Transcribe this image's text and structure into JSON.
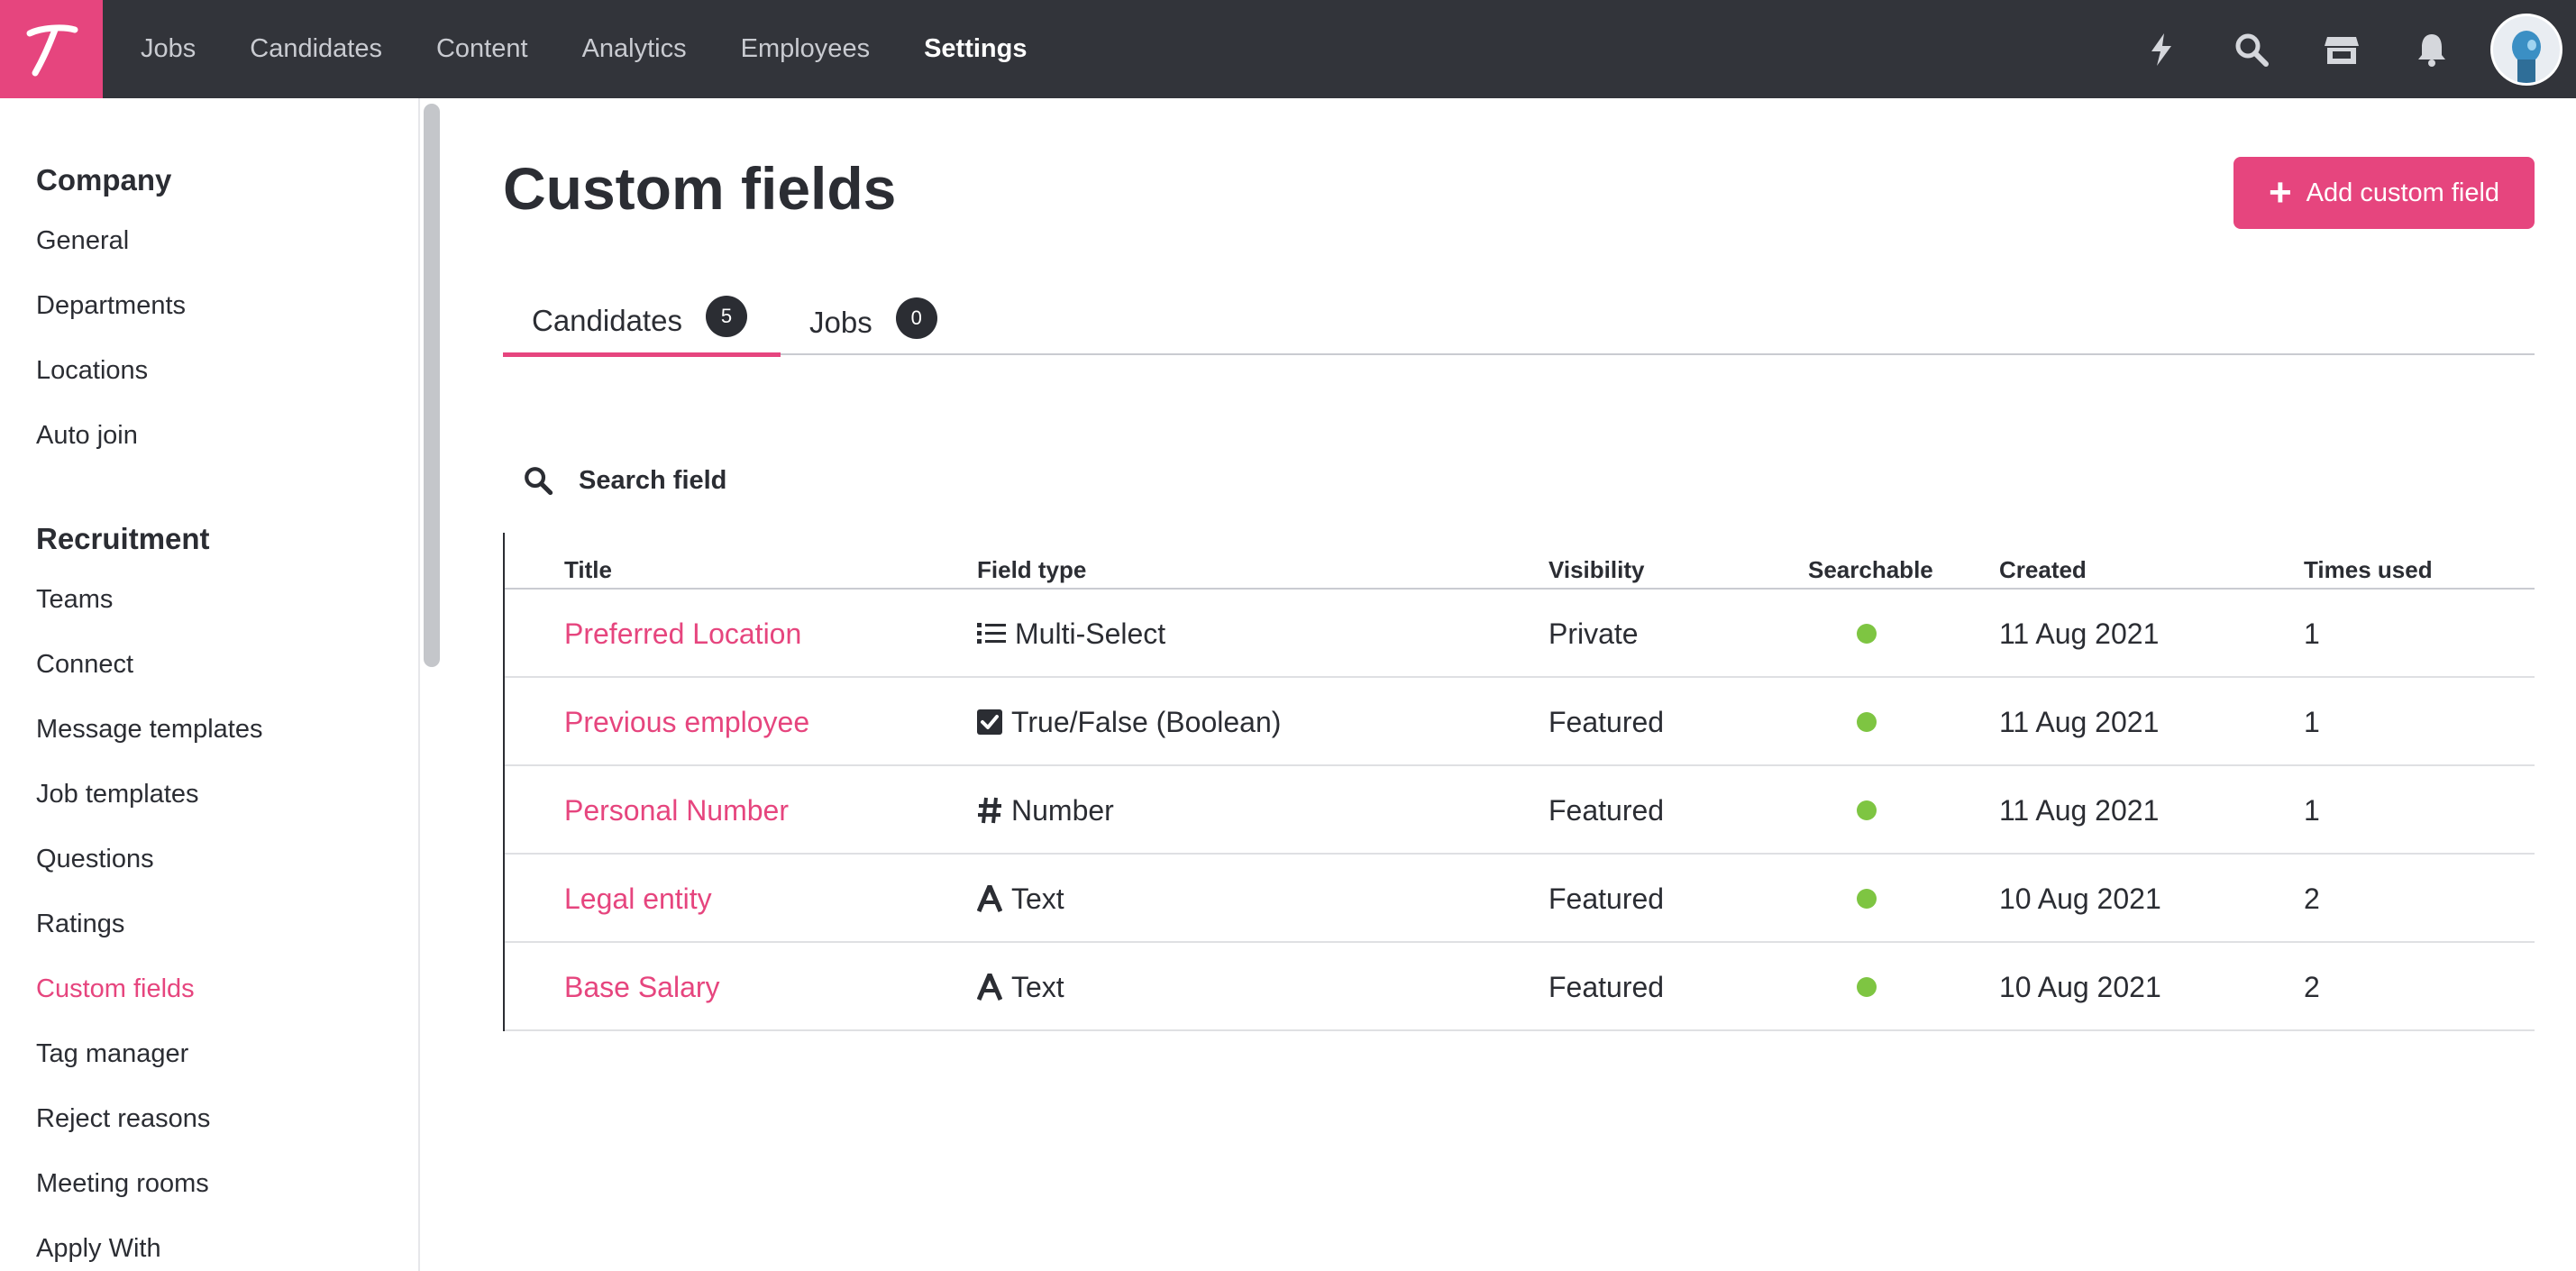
{
  "colors": {
    "accent": "#e6457e",
    "topbar": "#32343a",
    "searchable": "#7ec542"
  },
  "logo": {
    "letter": "T"
  },
  "nav": {
    "items": [
      {
        "label": "Jobs"
      },
      {
        "label": "Candidates"
      },
      {
        "label": "Content"
      },
      {
        "label": "Analytics"
      },
      {
        "label": "Employees"
      },
      {
        "label": "Settings",
        "active": true
      }
    ],
    "icons": [
      "lightning-icon",
      "search-icon",
      "store-icon",
      "bell-icon"
    ]
  },
  "sidebar": {
    "company_label": "Company",
    "company_items": [
      "General",
      "Departments",
      "Locations",
      "Auto join"
    ],
    "recruitment_label": "Recruitment",
    "recruitment_items": [
      "Teams",
      "Connect",
      "Message templates",
      "Job templates",
      "Questions",
      "Ratings",
      "Custom fields",
      "Tag manager",
      "Reject reasons",
      "Meeting rooms",
      "Apply With"
    ],
    "active_item": "Custom fields"
  },
  "main": {
    "title": "Custom fields",
    "add_button": "Add custom field",
    "tabs": [
      {
        "label": "Candidates",
        "count": "5",
        "active": true
      },
      {
        "label": "Jobs",
        "count": "0"
      }
    ],
    "search_placeholder": "Search field",
    "columns": [
      "Title",
      "Field type",
      "Visibility",
      "Searchable",
      "Created",
      "Times used"
    ],
    "rows": [
      {
        "title": "Preferred Location",
        "field_type": "Multi-Select",
        "type_icon": "list-icon",
        "visibility": "Private",
        "searchable": true,
        "created": "11 Aug 2021",
        "times_used": "1"
      },
      {
        "title": "Previous employee",
        "field_type": "True/False (Boolean)",
        "type_icon": "checkbox-icon",
        "visibility": "Featured",
        "searchable": true,
        "created": "11 Aug 2021",
        "times_used": "1"
      },
      {
        "title": "Personal Number",
        "field_type": "Number",
        "type_icon": "hash-icon",
        "visibility": "Featured",
        "searchable": true,
        "created": "11 Aug 2021",
        "times_used": "1"
      },
      {
        "title": "Legal entity",
        "field_type": "Text",
        "type_icon": "text-icon",
        "visibility": "Featured",
        "searchable": true,
        "created": "10 Aug 2021",
        "times_used": "2"
      },
      {
        "title": "Base Salary",
        "field_type": "Text",
        "type_icon": "text-icon",
        "visibility": "Featured",
        "searchable": true,
        "created": "10 Aug 2021",
        "times_used": "2"
      }
    ]
  }
}
